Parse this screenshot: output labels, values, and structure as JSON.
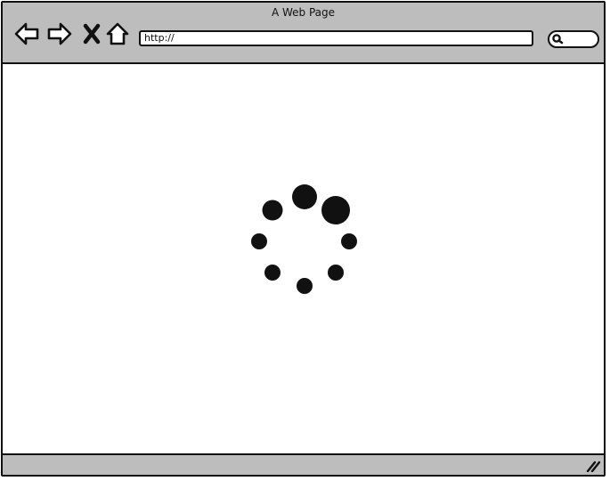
{
  "window": {
    "title": "A Web Page"
  },
  "toolbar": {
    "back_icon": "back-arrow-icon",
    "forward_icon": "forward-arrow-icon",
    "stop_icon": "stop-x-icon",
    "home_icon": "home-icon"
  },
  "address_bar": {
    "value": "http://"
  },
  "search": {
    "icon": "search-icon"
  },
  "content": {
    "state": "loading",
    "spinner_icon": "loading-spinner-icon"
  },
  "status_bar": {
    "grip_icon": "resize-grip-icon"
  },
  "colors": {
    "chrome": "#bdbdbd",
    "outline": "#111111",
    "content_bg": "#ffffff"
  }
}
